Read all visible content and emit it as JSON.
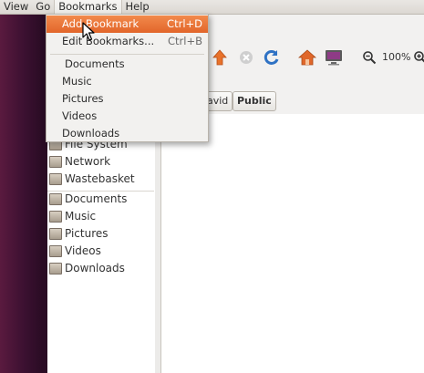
{
  "menubar": {
    "items": [
      "View",
      "Go",
      "Bookmarks",
      "Help"
    ]
  },
  "bookmarks_menu": {
    "add_label": "Add Bookmark",
    "add_shortcut": "Ctrl+D",
    "edit_label": "Edit Bookmarks...",
    "edit_shortcut": "Ctrl+B",
    "bookmarks": [
      "Documents",
      "Music",
      "Pictures",
      "Videos",
      "Downloads"
    ]
  },
  "toolbar": {
    "zoom": "100%"
  },
  "pathbar": {
    "buttons": [
      "avid",
      "Public"
    ]
  },
  "sidebar": {
    "devices": [
      "File System",
      "Network",
      "Wastebasket"
    ],
    "places": [
      "Documents",
      "Music",
      "Pictures",
      "Videos",
      "Downloads"
    ]
  },
  "colors": {
    "highlight": "#e2652a",
    "desktop": "#2a0c24"
  },
  "icons": {
    "up": "arrow-up-icon",
    "stop": "stop-icon",
    "reload": "reload-icon",
    "home": "home-icon",
    "computer": "computer-icon",
    "zoom_out": "zoom-out-icon",
    "zoom_in": "zoom-in-icon"
  }
}
